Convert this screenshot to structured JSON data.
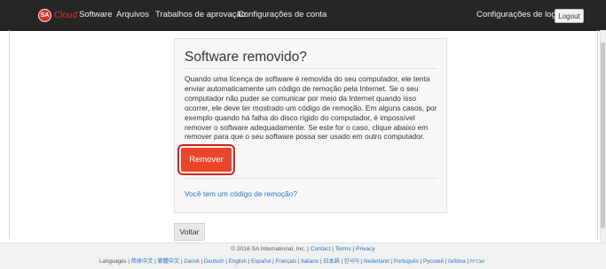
{
  "topbar": {
    "logo_badge": "SA",
    "logo_text": "Cloud",
    "nav": [
      "Software",
      "Arquivos",
      "Trabalhos de aprovação",
      "Configurações de conta"
    ],
    "login_settings": "Configurações de login",
    "logout": "Logout"
  },
  "card": {
    "title": "Software removido?",
    "body": "Quando uma licença de software é removida do seu computador, ele tenta enviar automaticamente um código de remoção pela Internet. Se o seu computador não puder se comunicar por meio da Internet quando isso ocorrer, ele deve ter mostrado um código de remoção. Em alguns casos, por exemplo quando há falha do disco rígido do computador, é impossível remover o software adequadamente. Se este for o caso, clique abaixo em remover para que o seu software possa ser usado em outro computador.",
    "remove": "Remover",
    "removal_link": "Você tem um código de remoção?"
  },
  "back": "Voltar",
  "footer": {
    "copyright": "© 2016 SA International, Inc. |",
    "contact": "Contact",
    "terms": "Terms",
    "privacy": "Privacy",
    "languages_label": "Languages",
    "languages": [
      "简体中文",
      "繁體中文",
      "Dansk",
      "Deutsch",
      "English",
      "Español",
      "Français",
      "Italiano",
      "日本語",
      "한국어",
      "Nederland",
      "Português",
      "Русский",
      "čeština",
      "עברית"
    ]
  }
}
